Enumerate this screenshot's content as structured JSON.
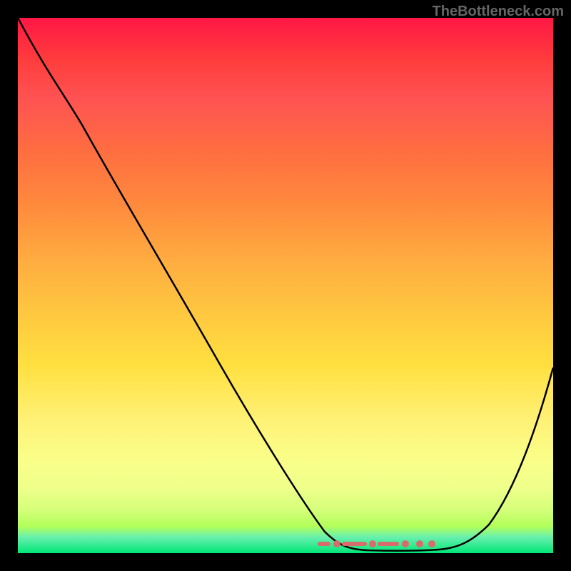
{
  "watermark": "TheBottleneck.com",
  "chart_data": {
    "type": "line",
    "title": "",
    "xlabel": "",
    "ylabel": "",
    "xlim": [
      0,
      100
    ],
    "ylim": [
      0,
      100
    ],
    "x": [
      0,
      4,
      10,
      20,
      30,
      40,
      50,
      58,
      62,
      68,
      75,
      80,
      85,
      90,
      95,
      100
    ],
    "values": [
      100,
      90,
      80,
      65,
      50,
      35,
      20,
      8,
      2,
      0,
      0,
      0,
      3,
      10,
      22,
      38
    ],
    "marker_region_x": [
      58,
      80
    ],
    "gradient": "rainbow-vertical",
    "background": "black-border"
  }
}
